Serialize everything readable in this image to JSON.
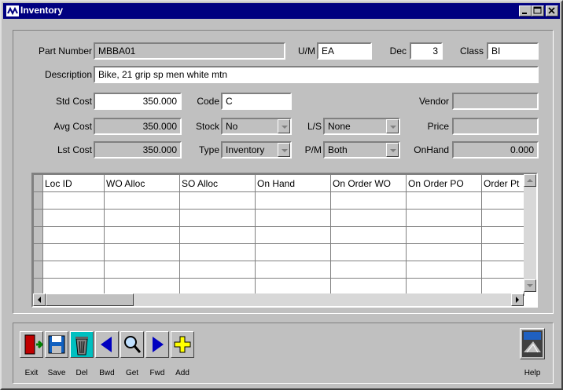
{
  "window": {
    "title": "Inventory"
  },
  "form": {
    "part_number": {
      "label": "Part Number",
      "value": "MBBA01"
    },
    "um": {
      "label": "U/M",
      "value": "EA"
    },
    "dec": {
      "label": "Dec",
      "value": "3"
    },
    "class": {
      "label": "Class",
      "value": "BI"
    },
    "description": {
      "label": "Description",
      "value": "Bike, 21 grip sp men white mtn"
    },
    "std_cost": {
      "label": "Std Cost",
      "value": "350.000"
    },
    "avg_cost": {
      "label": "Avg Cost",
      "value": "350.000"
    },
    "lst_cost": {
      "label": "Lst Cost",
      "value": "350.000"
    },
    "code": {
      "label": "Code",
      "value": "C"
    },
    "stock": {
      "label": "Stock",
      "value": "No"
    },
    "type": {
      "label": "Type",
      "value": "Inventory"
    },
    "ls": {
      "label": "L/S",
      "value": "None"
    },
    "pm": {
      "label": "P/M",
      "value": "Both"
    },
    "vendor": {
      "label": "Vendor",
      "value": ""
    },
    "price": {
      "label": "Price",
      "value": ""
    },
    "onhand": {
      "label": "OnHand",
      "value": "0.000"
    }
  },
  "grid": {
    "columns": [
      "Loc ID",
      "WO Alloc",
      "SO Alloc",
      "On Hand",
      "On Order WO",
      "On Order PO",
      "Order Pt"
    ]
  },
  "toolbar": {
    "exit": "Exit",
    "save": "Save",
    "del": "Del",
    "bwd": "Bwd",
    "get": "Get",
    "fwd": "Fwd",
    "add": "Add",
    "help": "Help"
  },
  "colors": {
    "titlebar": "#000080",
    "face": "#c0c0c0",
    "accent_teal": "#00c0c0"
  }
}
